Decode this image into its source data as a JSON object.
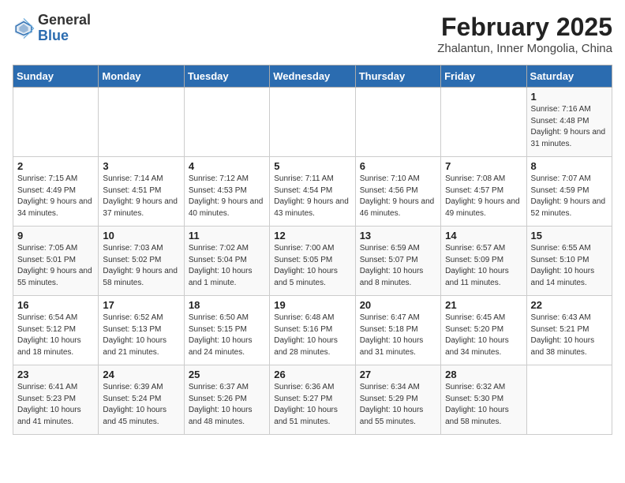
{
  "header": {
    "logo_general": "General",
    "logo_blue": "Blue",
    "title": "February 2025",
    "subtitle": "Zhalantun, Inner Mongolia, China"
  },
  "weekdays": [
    "Sunday",
    "Monday",
    "Tuesday",
    "Wednesday",
    "Thursday",
    "Friday",
    "Saturday"
  ],
  "weeks": [
    [
      {
        "day": "",
        "info": ""
      },
      {
        "day": "",
        "info": ""
      },
      {
        "day": "",
        "info": ""
      },
      {
        "day": "",
        "info": ""
      },
      {
        "day": "",
        "info": ""
      },
      {
        "day": "",
        "info": ""
      },
      {
        "day": "1",
        "info": "Sunrise: 7:16 AM\nSunset: 4:48 PM\nDaylight: 9 hours and 31 minutes."
      }
    ],
    [
      {
        "day": "2",
        "info": "Sunrise: 7:15 AM\nSunset: 4:49 PM\nDaylight: 9 hours and 34 minutes."
      },
      {
        "day": "3",
        "info": "Sunrise: 7:14 AM\nSunset: 4:51 PM\nDaylight: 9 hours and 37 minutes."
      },
      {
        "day": "4",
        "info": "Sunrise: 7:12 AM\nSunset: 4:53 PM\nDaylight: 9 hours and 40 minutes."
      },
      {
        "day": "5",
        "info": "Sunrise: 7:11 AM\nSunset: 4:54 PM\nDaylight: 9 hours and 43 minutes."
      },
      {
        "day": "6",
        "info": "Sunrise: 7:10 AM\nSunset: 4:56 PM\nDaylight: 9 hours and 46 minutes."
      },
      {
        "day": "7",
        "info": "Sunrise: 7:08 AM\nSunset: 4:57 PM\nDaylight: 9 hours and 49 minutes."
      },
      {
        "day": "8",
        "info": "Sunrise: 7:07 AM\nSunset: 4:59 PM\nDaylight: 9 hours and 52 minutes."
      }
    ],
    [
      {
        "day": "9",
        "info": "Sunrise: 7:05 AM\nSunset: 5:01 PM\nDaylight: 9 hours and 55 minutes."
      },
      {
        "day": "10",
        "info": "Sunrise: 7:03 AM\nSunset: 5:02 PM\nDaylight: 9 hours and 58 minutes."
      },
      {
        "day": "11",
        "info": "Sunrise: 7:02 AM\nSunset: 5:04 PM\nDaylight: 10 hours and 1 minute."
      },
      {
        "day": "12",
        "info": "Sunrise: 7:00 AM\nSunset: 5:05 PM\nDaylight: 10 hours and 5 minutes."
      },
      {
        "day": "13",
        "info": "Sunrise: 6:59 AM\nSunset: 5:07 PM\nDaylight: 10 hours and 8 minutes."
      },
      {
        "day": "14",
        "info": "Sunrise: 6:57 AM\nSunset: 5:09 PM\nDaylight: 10 hours and 11 minutes."
      },
      {
        "day": "15",
        "info": "Sunrise: 6:55 AM\nSunset: 5:10 PM\nDaylight: 10 hours and 14 minutes."
      }
    ],
    [
      {
        "day": "16",
        "info": "Sunrise: 6:54 AM\nSunset: 5:12 PM\nDaylight: 10 hours and 18 minutes."
      },
      {
        "day": "17",
        "info": "Sunrise: 6:52 AM\nSunset: 5:13 PM\nDaylight: 10 hours and 21 minutes."
      },
      {
        "day": "18",
        "info": "Sunrise: 6:50 AM\nSunset: 5:15 PM\nDaylight: 10 hours and 24 minutes."
      },
      {
        "day": "19",
        "info": "Sunrise: 6:48 AM\nSunset: 5:16 PM\nDaylight: 10 hours and 28 minutes."
      },
      {
        "day": "20",
        "info": "Sunrise: 6:47 AM\nSunset: 5:18 PM\nDaylight: 10 hours and 31 minutes."
      },
      {
        "day": "21",
        "info": "Sunrise: 6:45 AM\nSunset: 5:20 PM\nDaylight: 10 hours and 34 minutes."
      },
      {
        "day": "22",
        "info": "Sunrise: 6:43 AM\nSunset: 5:21 PM\nDaylight: 10 hours and 38 minutes."
      }
    ],
    [
      {
        "day": "23",
        "info": "Sunrise: 6:41 AM\nSunset: 5:23 PM\nDaylight: 10 hours and 41 minutes."
      },
      {
        "day": "24",
        "info": "Sunrise: 6:39 AM\nSunset: 5:24 PM\nDaylight: 10 hours and 45 minutes."
      },
      {
        "day": "25",
        "info": "Sunrise: 6:37 AM\nSunset: 5:26 PM\nDaylight: 10 hours and 48 minutes."
      },
      {
        "day": "26",
        "info": "Sunrise: 6:36 AM\nSunset: 5:27 PM\nDaylight: 10 hours and 51 minutes."
      },
      {
        "day": "27",
        "info": "Sunrise: 6:34 AM\nSunset: 5:29 PM\nDaylight: 10 hours and 55 minutes."
      },
      {
        "day": "28",
        "info": "Sunrise: 6:32 AM\nSunset: 5:30 PM\nDaylight: 10 hours and 58 minutes."
      },
      {
        "day": "",
        "info": ""
      }
    ]
  ]
}
